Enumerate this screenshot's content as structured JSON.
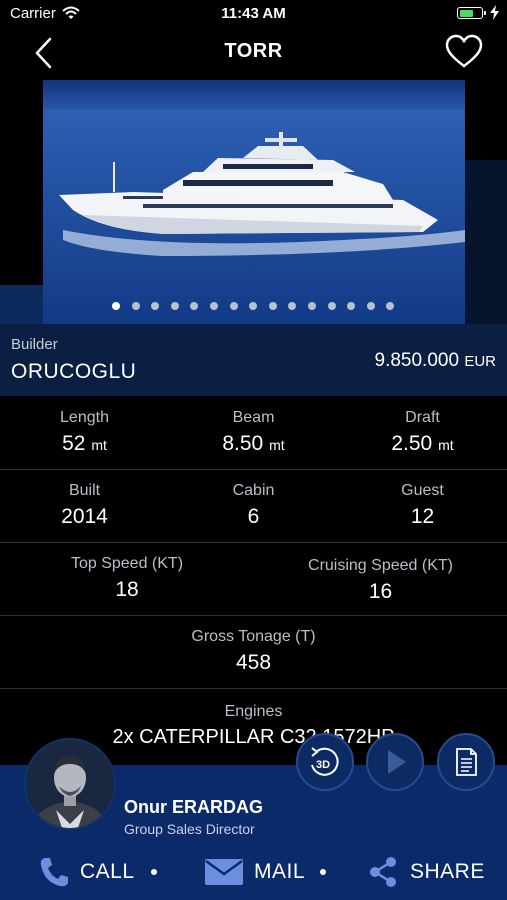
{
  "status": {
    "carrier": "Carrier",
    "time": "11:43 AM"
  },
  "nav": {
    "title": "TORR"
  },
  "gallery": {
    "dot_count": 15,
    "active_index": 0
  },
  "builder": {
    "label": "Builder",
    "name": "ORUCOGLU",
    "price": "9.850.000",
    "currency": "EUR"
  },
  "specs": {
    "length": {
      "label": "Length",
      "value": "52",
      "unit": "mt"
    },
    "beam": {
      "label": "Beam",
      "value": "8.50",
      "unit": "mt"
    },
    "draft": {
      "label": "Draft",
      "value": "2.50",
      "unit": "mt"
    },
    "built": {
      "label": "Built",
      "value": "2014"
    },
    "cabin": {
      "label": "Cabin",
      "value": "6"
    },
    "guest": {
      "label": "Guest",
      "value": "12"
    },
    "top_speed": {
      "label": "Top Speed (KT)",
      "value": "18"
    },
    "cruising_speed": {
      "label": "Cruising Speed (KT)",
      "value": "16"
    },
    "gross_tonage": {
      "label": "Gross Tonage (T)",
      "value": "458"
    },
    "engines": {
      "label": "Engines",
      "value": "2x CATERPILLAR C32 1572HP"
    }
  },
  "agent": {
    "name": "Onur ERARDAG",
    "role": "Group Sales Director"
  },
  "floating": {
    "three_d_label": "3D"
  },
  "actions": {
    "call": "CALL",
    "mail": "MAIL",
    "share": "SHARE"
  },
  "colors": {
    "panel": "#0a2a6a",
    "builder_bg": "#0b1f43",
    "sea": "#1f4f9e",
    "battery": "#4cd964"
  }
}
